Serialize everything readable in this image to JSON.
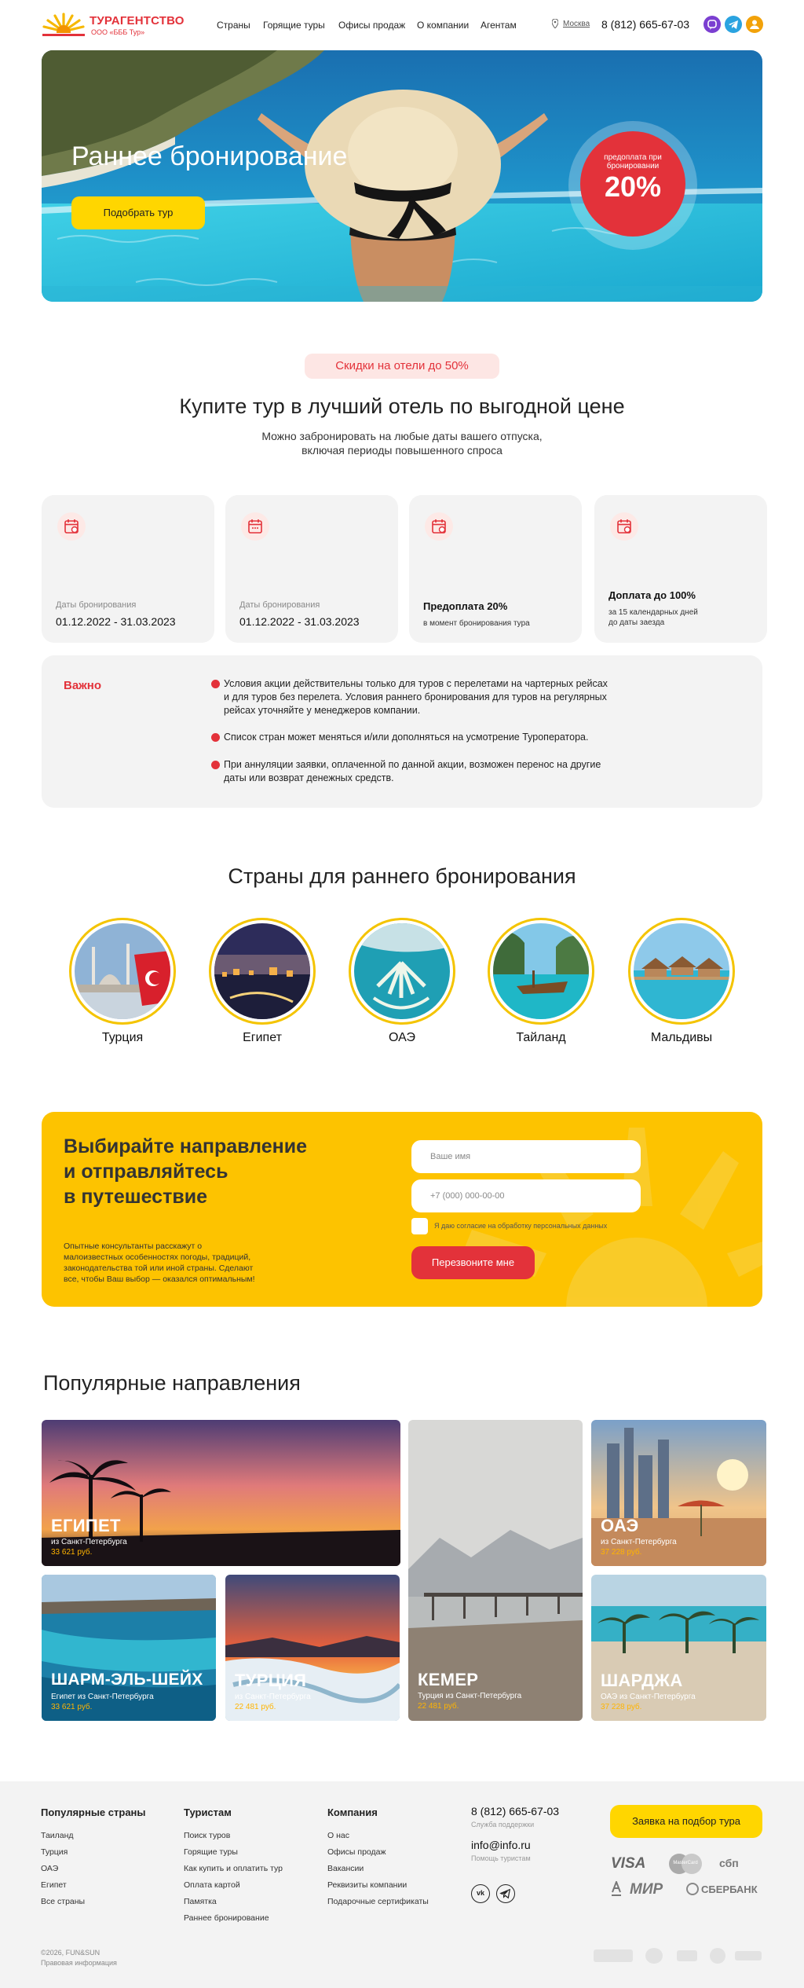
{
  "header": {
    "logo_title": "ТУРАГЕНТСТВО",
    "logo_sub": "ООО «БББ Тур»",
    "nav": [
      "Страны",
      "Горящие туры",
      "Офисы продаж",
      "О компании",
      "Агентам"
    ],
    "city": "Москва",
    "phone": "8 (812) 665-67-03",
    "icons": [
      "viber-icon",
      "telegram-icon",
      "user-icon"
    ]
  },
  "hero": {
    "title": "Раннее бронирование",
    "button": "Подобрать тур",
    "badge_small": "предоплата при бронировании",
    "badge_big": "20%"
  },
  "discount": {
    "pill": "Скидки на отели до 50%",
    "title": "Купите тур в лучший отель по выгодной цене",
    "subtitle_line1": "Можно забронировать на любые даты вашего отпуска,",
    "subtitle_line2": "включая периоды повышенного спроса"
  },
  "cards": [
    {
      "label": "Даты бронирования",
      "value": "01.12.2022 - 31.03.2023"
    },
    {
      "label": "Даты бронирования",
      "value": "01.12.2022 - 31.03.2023"
    },
    {
      "title": "Предоплата 20%",
      "note": "в момент бронирования тура"
    },
    {
      "title": "Доплата до 100%",
      "note_line1": "за 15 календарных дней",
      "note_line2": "до даты заезда"
    }
  ],
  "important": {
    "title": "Важно",
    "items": [
      [
        "Условия акции действительны только для туров с перелетами на чартерных рейсах",
        "и для туров без перелета. Условия раннего бронирования для туров на регулярных",
        "рейсах уточняйте у менеджеров компании."
      ],
      [
        "Список стран может меняться и/или дополняться на усмотрение Туроператора."
      ],
      [
        "При аннуляции заявки, оплаченной по данной акции, возможен перенос на другие",
        "даты или возврат денежных средств."
      ]
    ]
  },
  "countries": {
    "title": "Страны для раннего бронирования",
    "items": [
      "Турция",
      "Египет",
      "ОАЭ",
      "Тайланд",
      "Мальдивы"
    ]
  },
  "form": {
    "title_lines": [
      "Выбирайте направление",
      "и отправляйтесь",
      "в путешествие"
    ],
    "text_lines": [
      "Опытные консультанты  расскажут о",
      "малоизвестных особенностях погоды, традиций,",
      "законодательства той или иной страны. Сделают",
      "все, чтобы Ваш выбор — оказался оптимальным!"
    ],
    "name_placeholder": "Ваше имя",
    "phone_placeholder": "+7 (000) 000-00-00",
    "consent": "Я даю согласие на обработку персональных данных",
    "button": "Перезвоните мне"
  },
  "popular": {
    "title": "Популярные направления",
    "tiles": [
      {
        "name": "ЕГИПЕТ",
        "from": "из Санкт-Петербурга",
        "price": "33 621 руб."
      },
      {
        "name": "ОАЭ",
        "from": "из Санкт-Петербурга",
        "price": "37 228 руб."
      },
      {
        "name": "КЕМЕР",
        "from": "Турция из Санкт-Петербурга",
        "price": "22 481 руб."
      },
      {
        "name": "ШАРМ-ЭЛЬ-ШЕЙХ",
        "from": "Египет из Санкт-Петербурга",
        "price": "33 621 руб."
      },
      {
        "name": "ТУРЦИЯ",
        "from": "из Санкт-Петербурга",
        "price": "22 481 руб."
      },
      {
        "name": "ШАРДЖА",
        "from": "ОАЭ из Санкт-Петербурга",
        "price": "37 228 руб."
      }
    ]
  },
  "footer": {
    "col1": {
      "title": "Популярные страны",
      "items": [
        "Таиланд",
        "Турция",
        "ОАЭ",
        "Египет",
        "Все страны"
      ]
    },
    "col2": {
      "title": "Туристам",
      "items": [
        "Поиск туров",
        "Горящие туры",
        "Как купить и оплатить тур",
        "Оплата картой",
        "Памятка",
        "Раннее бронирование"
      ]
    },
    "col3": {
      "title": "Компания",
      "items": [
        "О нас",
        "Офисы продаж",
        "Вакансии",
        "Реквизиты компании",
        "Подарочные сертификаты"
      ]
    },
    "phone": "8 (812) 665-67-03",
    "phone_note": "Служба поддержки",
    "email": "info@info.ru",
    "email_note": "Помощь туристам",
    "button": "Заявка на подбор тура",
    "payments": [
      "VISA",
      "MasterCard",
      "сбп",
      "МИР",
      "СБЕРБАНК"
    ],
    "copyright": "©2026, FUN&SUN",
    "legal": "Правовая информация"
  },
  "colors": {
    "brand_red": "#e3323a",
    "brand_yellow": "#ffd600",
    "form_yellow": "#fdc300"
  }
}
